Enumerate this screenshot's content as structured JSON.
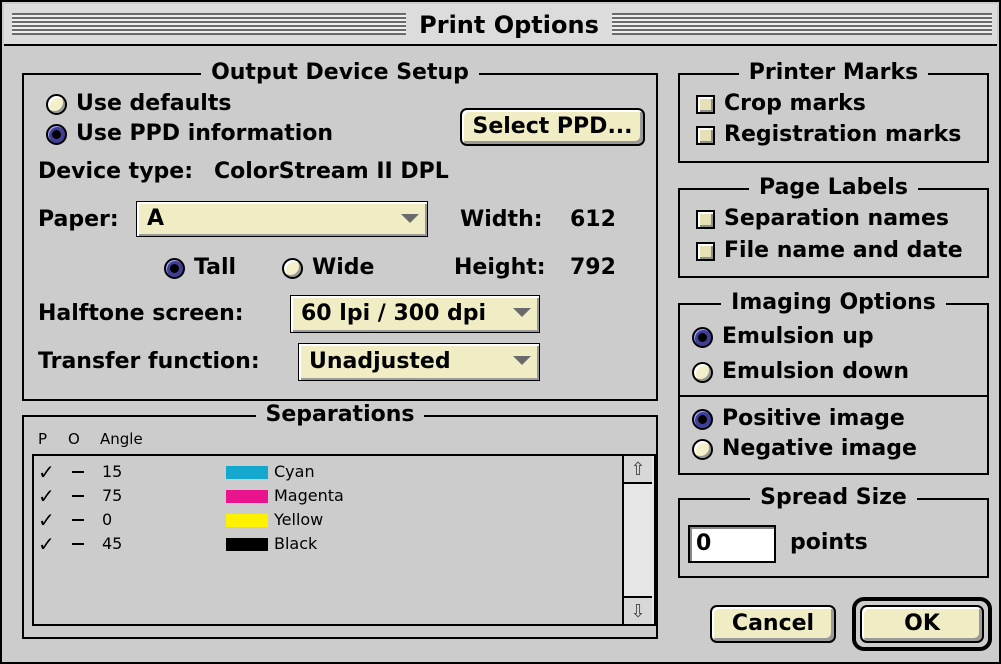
{
  "window": {
    "title": "Print Options"
  },
  "output_device": {
    "legend": "Output Device Setup",
    "use_defaults": "Use defaults",
    "use_ppd": "Use PPD information",
    "select_ppd_button": "Select PPD...",
    "device_type_label": "Device type:",
    "device_type_value": "ColorStream II DPL",
    "paper_label": "Paper:",
    "paper_value": "A",
    "width_label": "Width:",
    "width_value": "612",
    "height_label": "Height:",
    "height_value": "792",
    "tall": "Tall",
    "wide": "Wide",
    "halftone_label": "Halftone screen:",
    "halftone_value": "60 lpi / 300 dpi",
    "transfer_label": "Transfer function:",
    "transfer_value": "Unadjusted"
  },
  "separations": {
    "legend": "Separations",
    "headers": {
      "p": "P",
      "o": "O",
      "angle": "Angle"
    },
    "rows": [
      {
        "angle": "15",
        "name": "Cyan",
        "color": "#14a8cf"
      },
      {
        "angle": "75",
        "name": "Magenta",
        "color": "#ea138e"
      },
      {
        "angle": "0",
        "name": "Yellow",
        "color": "#fff200"
      },
      {
        "angle": "45",
        "name": "Black",
        "color": "#000000"
      }
    ]
  },
  "printer_marks": {
    "legend": "Printer Marks",
    "crop": "Crop marks",
    "registration": "Registration marks"
  },
  "page_labels": {
    "legend": "Page Labels",
    "separation_names": "Separation names",
    "file_name_date": "File name and date"
  },
  "imaging_options": {
    "legend": "Imaging Options",
    "emulsion_up": "Emulsion up",
    "emulsion_down": "Emulsion down",
    "positive": "Positive image",
    "negative": "Negative image"
  },
  "spread_size": {
    "legend": "Spread Size",
    "value": "0",
    "unit": "points"
  },
  "buttons": {
    "cancel": "Cancel",
    "ok": "OK"
  },
  "colors": {
    "dialog_bg": "#cccccc",
    "button_face": "#f0ecc4"
  }
}
